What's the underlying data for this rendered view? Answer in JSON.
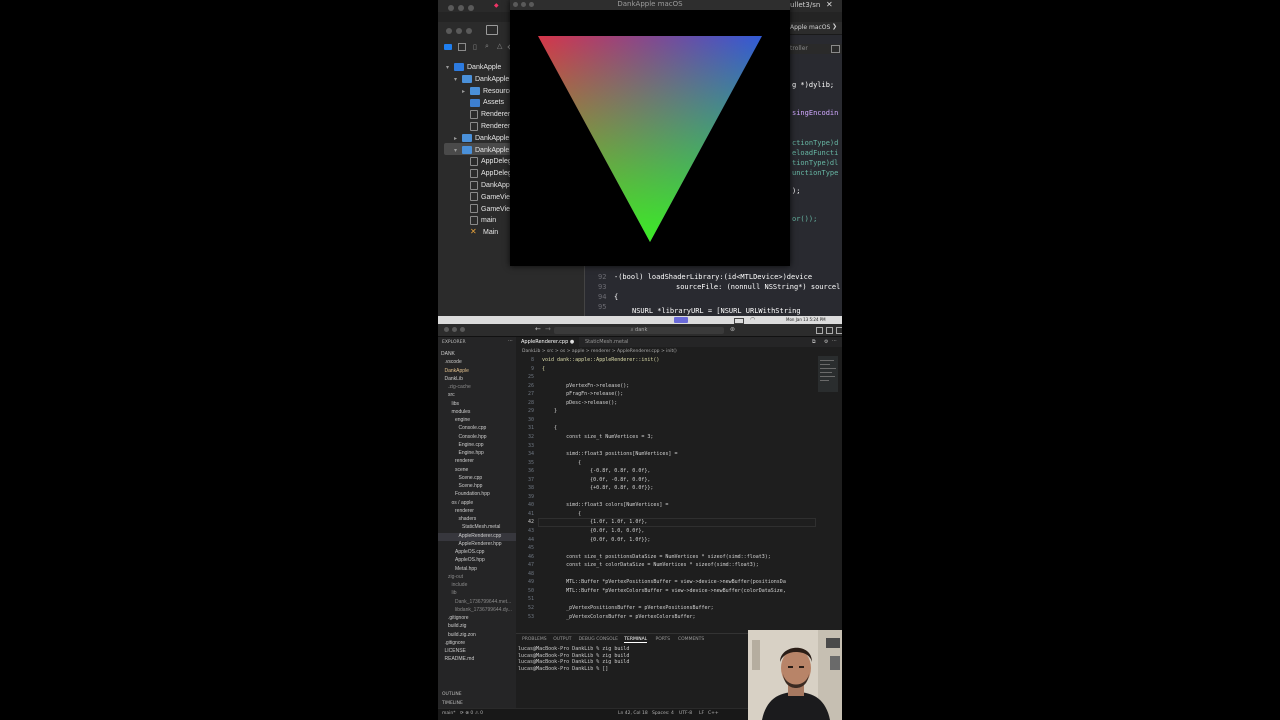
{
  "xcode": {
    "render_window_title": "DankApple macOS",
    "titlebar_right": "ullet3/sn",
    "scheme_label": "Apple macOS",
    "breadcrumb_right": "troller",
    "navigator": [
      {
        "label": "DankApple",
        "icon": "project-icon",
        "indent": 0,
        "chevron": "v"
      },
      {
        "label": "DankApple",
        "icon": "folder-icon",
        "indent": 1,
        "chevron": "v"
      },
      {
        "label": "Resource",
        "icon": "folder-icon",
        "indent": 2,
        "chevron": ">"
      },
      {
        "label": "Assets",
        "icon": "asset-icon",
        "indent": 2,
        "chevron": ""
      },
      {
        "label": "Renderer",
        "icon": "file-icon",
        "indent": 2,
        "chevron": ""
      },
      {
        "label": "Renderer",
        "icon": "file-icon",
        "indent": 2,
        "chevron": ""
      },
      {
        "label": "DankApple",
        "icon": "folder-icon",
        "indent": 1,
        "chevron": ">"
      },
      {
        "label": "DankApple",
        "icon": "folder-icon",
        "indent": 1,
        "chevron": "v"
      },
      {
        "label": "AppDeleg",
        "icon": "file-icon",
        "indent": 2,
        "chevron": ""
      },
      {
        "label": "AppDeleg",
        "icon": "file-icon",
        "indent": 2,
        "chevron": ""
      },
      {
        "label": "DankAppl",
        "icon": "file-icon",
        "indent": 2,
        "chevron": ""
      },
      {
        "label": "GameView",
        "icon": "file-icon",
        "indent": 2,
        "chevron": ""
      },
      {
        "label": "GameView",
        "icon": "file-icon",
        "indent": 2,
        "chevron": ""
      },
      {
        "label": "main",
        "icon": "file-icon",
        "indent": 2,
        "chevron": ""
      },
      {
        "label": "Main",
        "icon": "xib-icon",
        "indent": 2,
        "chevron": ""
      }
    ],
    "code_fragments": [
      "g *)dylib; ",
      "singEncodin",
      "ctionType)d",
      "eloadFuncti",
      "tionType)dl",
      "unctionType",
      ");",
      "or());"
    ],
    "line_numbers": [
      "92",
      "93",
      "94",
      "95"
    ],
    "code_92": "-(bool) loadShaderLibrary:(id<MTLDevice>)device",
    "code_93": "sourceFile: (nonnull NSString*) sourcel",
    "code_94": "{",
    "code_95": "NSURL *libraryURL = [NSURL URLWithString"
  },
  "menubar": {
    "clock": "Mon Jan 13  5:24 PM"
  },
  "vscode": {
    "search_text": "dank",
    "explorer_title": "EXPLORER",
    "tree": [
      {
        "label": "DANK",
        "indent": 0,
        "color": "#cccccc"
      },
      {
        "label": ".vscode",
        "indent": 1,
        "color": "#cccccc"
      },
      {
        "label": "DankApple",
        "indent": 1,
        "color": "#e2c08d"
      },
      {
        "label": "DankLib",
        "indent": 1,
        "color": "#cccccc"
      },
      {
        "label": ".zig-cache",
        "indent": 2,
        "color": "#8a8a8a"
      },
      {
        "label": "src",
        "indent": 2,
        "color": "#cccccc"
      },
      {
        "label": "libs",
        "indent": 3,
        "color": "#cccccc"
      },
      {
        "label": "modules",
        "indent": 3,
        "color": "#cccccc"
      },
      {
        "label": "engine",
        "indent": 4,
        "color": "#cccccc"
      },
      {
        "label": "Console.cpp",
        "indent": 5,
        "color": "#cccccc"
      },
      {
        "label": "Console.hpp",
        "indent": 5,
        "color": "#cccccc"
      },
      {
        "label": "Engine.cpp",
        "indent": 5,
        "color": "#cccccc"
      },
      {
        "label": "Engine.hpp",
        "indent": 5,
        "color": "#cccccc"
      },
      {
        "label": "renderer",
        "indent": 4,
        "color": "#cccccc"
      },
      {
        "label": "scene",
        "indent": 4,
        "color": "#cccccc"
      },
      {
        "label": "Scene.cpp",
        "indent": 5,
        "color": "#cccccc"
      },
      {
        "label": "Scene.hpp",
        "indent": 5,
        "color": "#cccccc"
      },
      {
        "label": "Foundation.hpp",
        "indent": 4,
        "color": "#cccccc"
      },
      {
        "label": "os / apple",
        "indent": 3,
        "color": "#cccccc"
      },
      {
        "label": "renderer",
        "indent": 4,
        "color": "#cccccc"
      },
      {
        "label": "shaders",
        "indent": 5,
        "color": "#cccccc"
      },
      {
        "label": "StaticMesh.metal",
        "indent": 6,
        "color": "#cccccc"
      },
      {
        "label": "AppleRenderer.cpp",
        "indent": 5,
        "color": "#cccccc"
      },
      {
        "label": "AppleRenderer.hpp",
        "indent": 5,
        "color": "#cccccc"
      },
      {
        "label": "AppleOS.cpp",
        "indent": 4,
        "color": "#cccccc"
      },
      {
        "label": "AppleOS.hpp",
        "indent": 4,
        "color": "#cccccc"
      },
      {
        "label": "Metal.hpp",
        "indent": 4,
        "color": "#cccccc"
      },
      {
        "label": "zig-out",
        "indent": 2,
        "color": "#8a8a8a"
      },
      {
        "label": "include",
        "indent": 3,
        "color": "#8a8a8a"
      },
      {
        "label": "lib",
        "indent": 3,
        "color": "#8a8a8a"
      },
      {
        "label": "Dank_1736799644.met...",
        "indent": 4,
        "color": "#8a8a8a"
      },
      {
        "label": "libdank_1736799644.dy...",
        "indent": 4,
        "color": "#8a8a8a"
      },
      {
        "label": ".gitignore",
        "indent": 2,
        "color": "#cccccc"
      },
      {
        "label": "build.zig",
        "indent": 2,
        "color": "#cccccc"
      },
      {
        "label": "build.zig.zon",
        "indent": 2,
        "color": "#cccccc"
      },
      {
        "label": ".gitignore",
        "indent": 1,
        "color": "#cccccc"
      },
      {
        "label": "LICENSE",
        "indent": 1,
        "color": "#cccccc"
      },
      {
        "label": "README.md",
        "indent": 1,
        "color": "#cccccc"
      }
    ],
    "outline_label": "OUTLINE",
    "timeline_label": "TIMELINE",
    "tabs": [
      {
        "label": "AppleRenderer.cpp",
        "active": true
      },
      {
        "label": "StaticMesh.metal",
        "active": false
      }
    ],
    "breadcrumb": "DankLib > src > os > apple > renderer > AppleRenderer.cpp > init()",
    "sticky_9": "void dank::apple::AppleRenderer::init()",
    "code_lines": [
      {
        "n": "8",
        "t": "void dank::apple::AppleRenderer::init()"
      },
      {
        "n": "9",
        "t": "{"
      },
      {
        "n": "25",
        "t": ""
      },
      {
        "n": "26",
        "t": "        pVertexFn->release();"
      },
      {
        "n": "27",
        "t": "        pFragFn->release();"
      },
      {
        "n": "28",
        "t": "        pDesc->release();"
      },
      {
        "n": "29",
        "t": "    }"
      },
      {
        "n": "30",
        "t": ""
      },
      {
        "n": "31",
        "t": "    {"
      },
      {
        "n": "32",
        "t": "        const size_t NumVertices = 3;"
      },
      {
        "n": "33",
        "t": ""
      },
      {
        "n": "34",
        "t": "        simd::float3 positions[NumVertices] ="
      },
      {
        "n": "35",
        "t": "            {"
      },
      {
        "n": "36",
        "t": "                {-0.8f, 0.8f, 0.0f},"
      },
      {
        "n": "37",
        "t": "                {0.0f, -0.8f, 0.0f},"
      },
      {
        "n": "38",
        "t": "                {+0.8f, 0.8f, 0.0f}};"
      },
      {
        "n": "39",
        "t": ""
      },
      {
        "n": "40",
        "t": "        simd::float3 colors[NumVertices] ="
      },
      {
        "n": "41",
        "t": "            {"
      },
      {
        "n": "42",
        "t": "                {1.0f, 1.0f, 1.0f},"
      },
      {
        "n": "43",
        "t": "                {0.0f, 1.0, 0.0f},"
      },
      {
        "n": "44",
        "t": "                {0.0f, 0.0f, 1.0f}};"
      },
      {
        "n": "45",
        "t": ""
      },
      {
        "n": "46",
        "t": "        const size_t positionsDataSize = NumVertices * sizeof(simd::float3);"
      },
      {
        "n": "47",
        "t": "        const size_t colorDataSize = NumVertices * sizeof(simd::float3);"
      },
      {
        "n": "48",
        "t": ""
      },
      {
        "n": "49",
        "t": "        MTL::Buffer *pVertexPositionsBuffer = view->device->newBuffer(positionsDa"
      },
      {
        "n": "50",
        "t": "        MTL::Buffer *pVertexColorsBuffer = view->device->newBuffer(colorDataSize,"
      },
      {
        "n": "51",
        "t": ""
      },
      {
        "n": "52",
        "t": "        _pVertexPositionsBuffer = pVertexPositionsBuffer;"
      },
      {
        "n": "53",
        "t": "        _pVertexColorsBuffer = pVertexColorsBuffer;"
      }
    ],
    "panel_tabs": [
      "PROBLEMS",
      "OUTPUT",
      "DEBUG CONSOLE",
      "TERMINAL",
      "PORTS",
      "COMMENTS"
    ],
    "active_panel_tab": "TERMINAL",
    "terminal_lines": [
      "lucas@MacBook-Pro DankLib % zig build",
      "lucas@MacBook-Pro DankLib % zig build",
      "lucas@MacBook-Pro DankLib % zig build",
      "lucas@MacBook-Pro DankLib % []"
    ],
    "status": {
      "branch": "main*",
      "sync": "⟳ ⊗ 0 ⚠ 0",
      "position": "Ln 42, Col 18",
      "spaces": "Spaces: 4",
      "encoding": "UTF-8",
      "eol": "LF",
      "language": "C++"
    }
  },
  "colors": {
    "triangle_top_left": "#ff1a3a",
    "triangle_top_right": "#1a4dff",
    "triangle_bottom": "#33ff1a"
  }
}
